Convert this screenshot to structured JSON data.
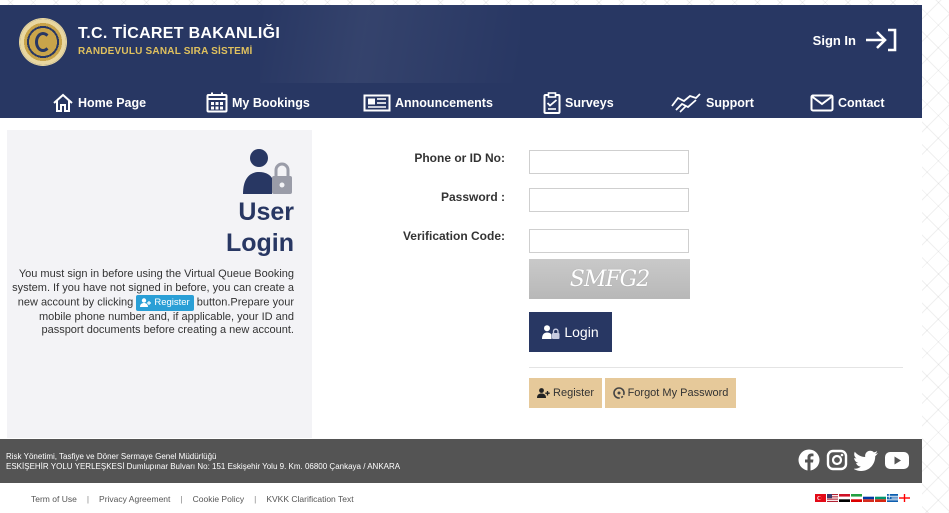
{
  "header": {
    "org_title": "T.C. TİCARET BAKANLIĞI",
    "org_subtitle": "RANDEVULU SANAL SIRA SİSTEMİ",
    "signin_label": "Sign In"
  },
  "nav": {
    "items": [
      {
        "label": "Home Page",
        "icon": "home-icon"
      },
      {
        "label": "My Bookings",
        "icon": "calendar-icon"
      },
      {
        "label": "Announcements",
        "icon": "newspaper-icon"
      },
      {
        "label": "Surveys",
        "icon": "clipboard-icon"
      },
      {
        "label": "Support",
        "icon": "handshake-icon"
      },
      {
        "label": "Contact",
        "icon": "envelope-icon"
      }
    ]
  },
  "left_panel": {
    "title_line1": "User",
    "title_line2": "Login",
    "desc_part1": "You must sign in before using the Virtual Queue Booking system. If you have not signed in before, you can create a new account by clicking",
    "inline_register_label": "Register",
    "desc_part2": "button.Prepare your mobile phone number and, if applicable, your ID and passport documents before creating a new account."
  },
  "form": {
    "phone_label": "Phone or ID No:",
    "phone_value": "",
    "password_label": "Password :",
    "password_value": "",
    "verification_label": "Verification Code:",
    "verification_value": "",
    "captcha_text": "SMFG2",
    "login_label": "Login",
    "register_label": "Register",
    "forgot_label": "Forgot My Password"
  },
  "footer": {
    "line1": "Risk Yönetimi, Tasfiye ve Döner Sermaye Genel Müdürlüğü",
    "line2": "ESKİŞEHİR YOLU YERLEŞKESİ Dumlupınar Bulvarı No: 151 Eskişehir Yolu 9. Km. 06800 Çankaya / ANKARA",
    "social": [
      "facebook-icon",
      "instagram-icon",
      "twitter-icon",
      "youtube-icon"
    ]
  },
  "subfooter": {
    "links": [
      "Term of Use",
      "Privacy Agreement",
      "Cookie Policy",
      "KVKK Clarification Text"
    ],
    "flags": [
      "flag-tr",
      "flag-us",
      "flag-ar",
      "flag-ir",
      "flag-ru",
      "flag-bg",
      "flag-gr",
      "flag-ge"
    ]
  },
  "colors": {
    "primary": "#283763",
    "accent_gold": "#e0c15e",
    "button_beige": "#e6c99a",
    "register_blue": "#2a9fd6",
    "footer_gray": "#545454"
  }
}
